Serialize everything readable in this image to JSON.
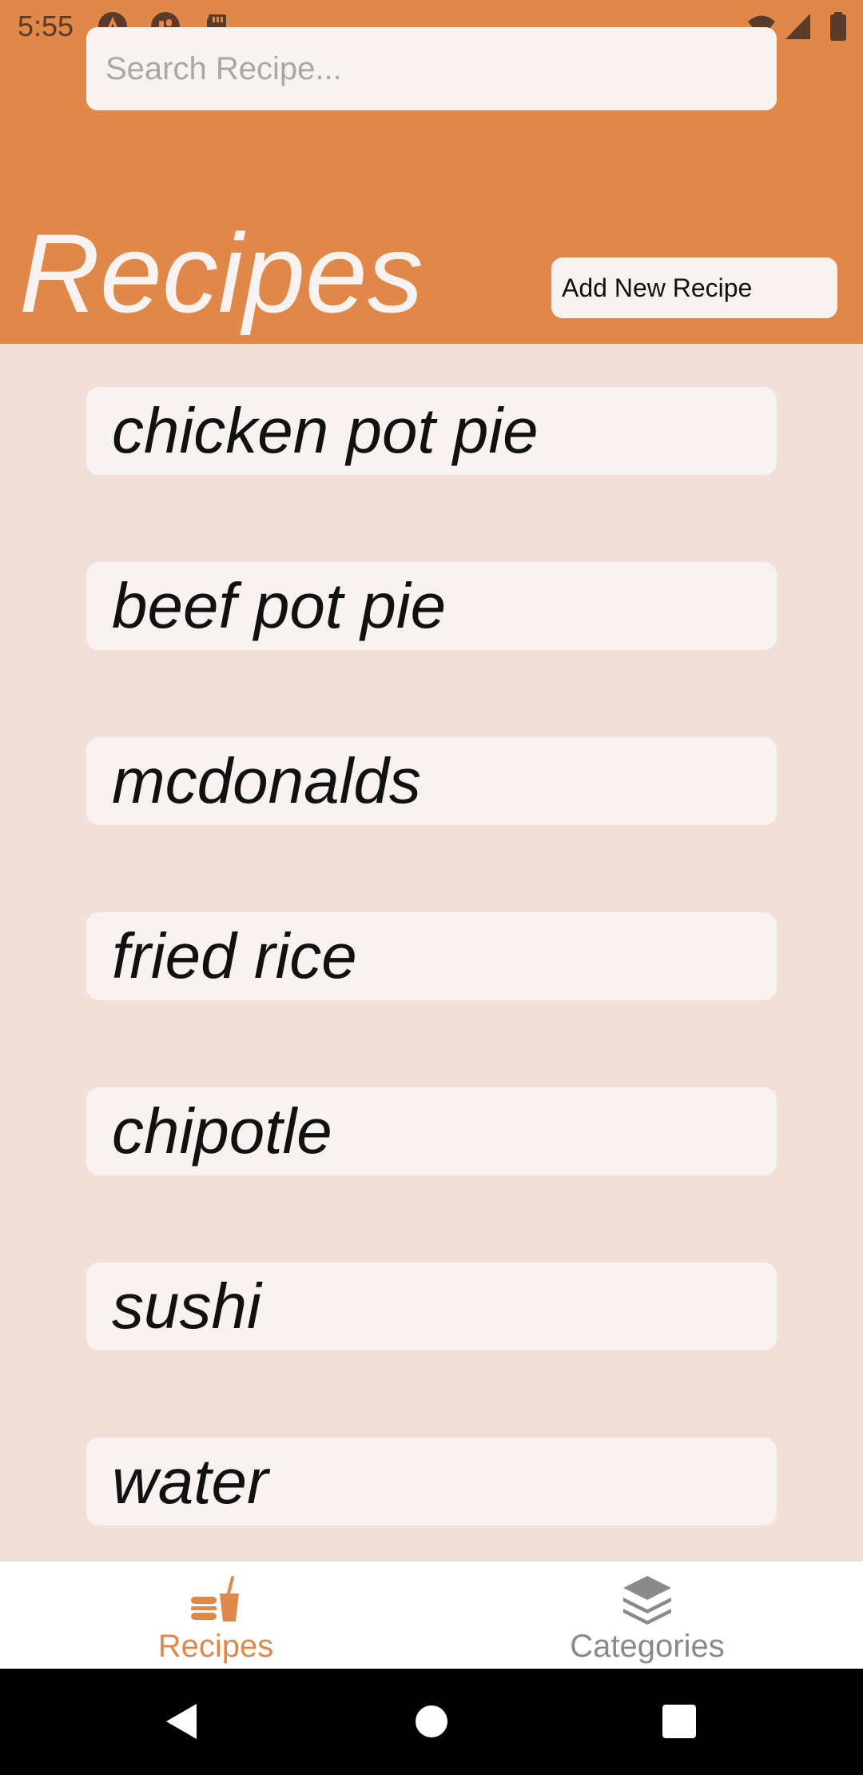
{
  "status_bar": {
    "time": "5:55"
  },
  "search": {
    "placeholder": "Search Recipe...",
    "value": ""
  },
  "header": {
    "title": "Recipes",
    "add_button_label": "Add New Recipe"
  },
  "recipes": [
    "chicken pot pie",
    "beef pot pie",
    "mcdonalds",
    "fried rice",
    "chipotle",
    "sushi",
    "water"
  ],
  "bottom_nav": {
    "tabs": [
      {
        "label": "Recipes",
        "icon": "food-drink-icon",
        "active": true
      },
      {
        "label": "Categories",
        "icon": "layers-icon",
        "active": false
      }
    ]
  },
  "colors": {
    "accent": "#e0884a",
    "background": "#f1dfd8",
    "card": "#f8f3f1",
    "inactive_tab": "#8a8a8a"
  }
}
